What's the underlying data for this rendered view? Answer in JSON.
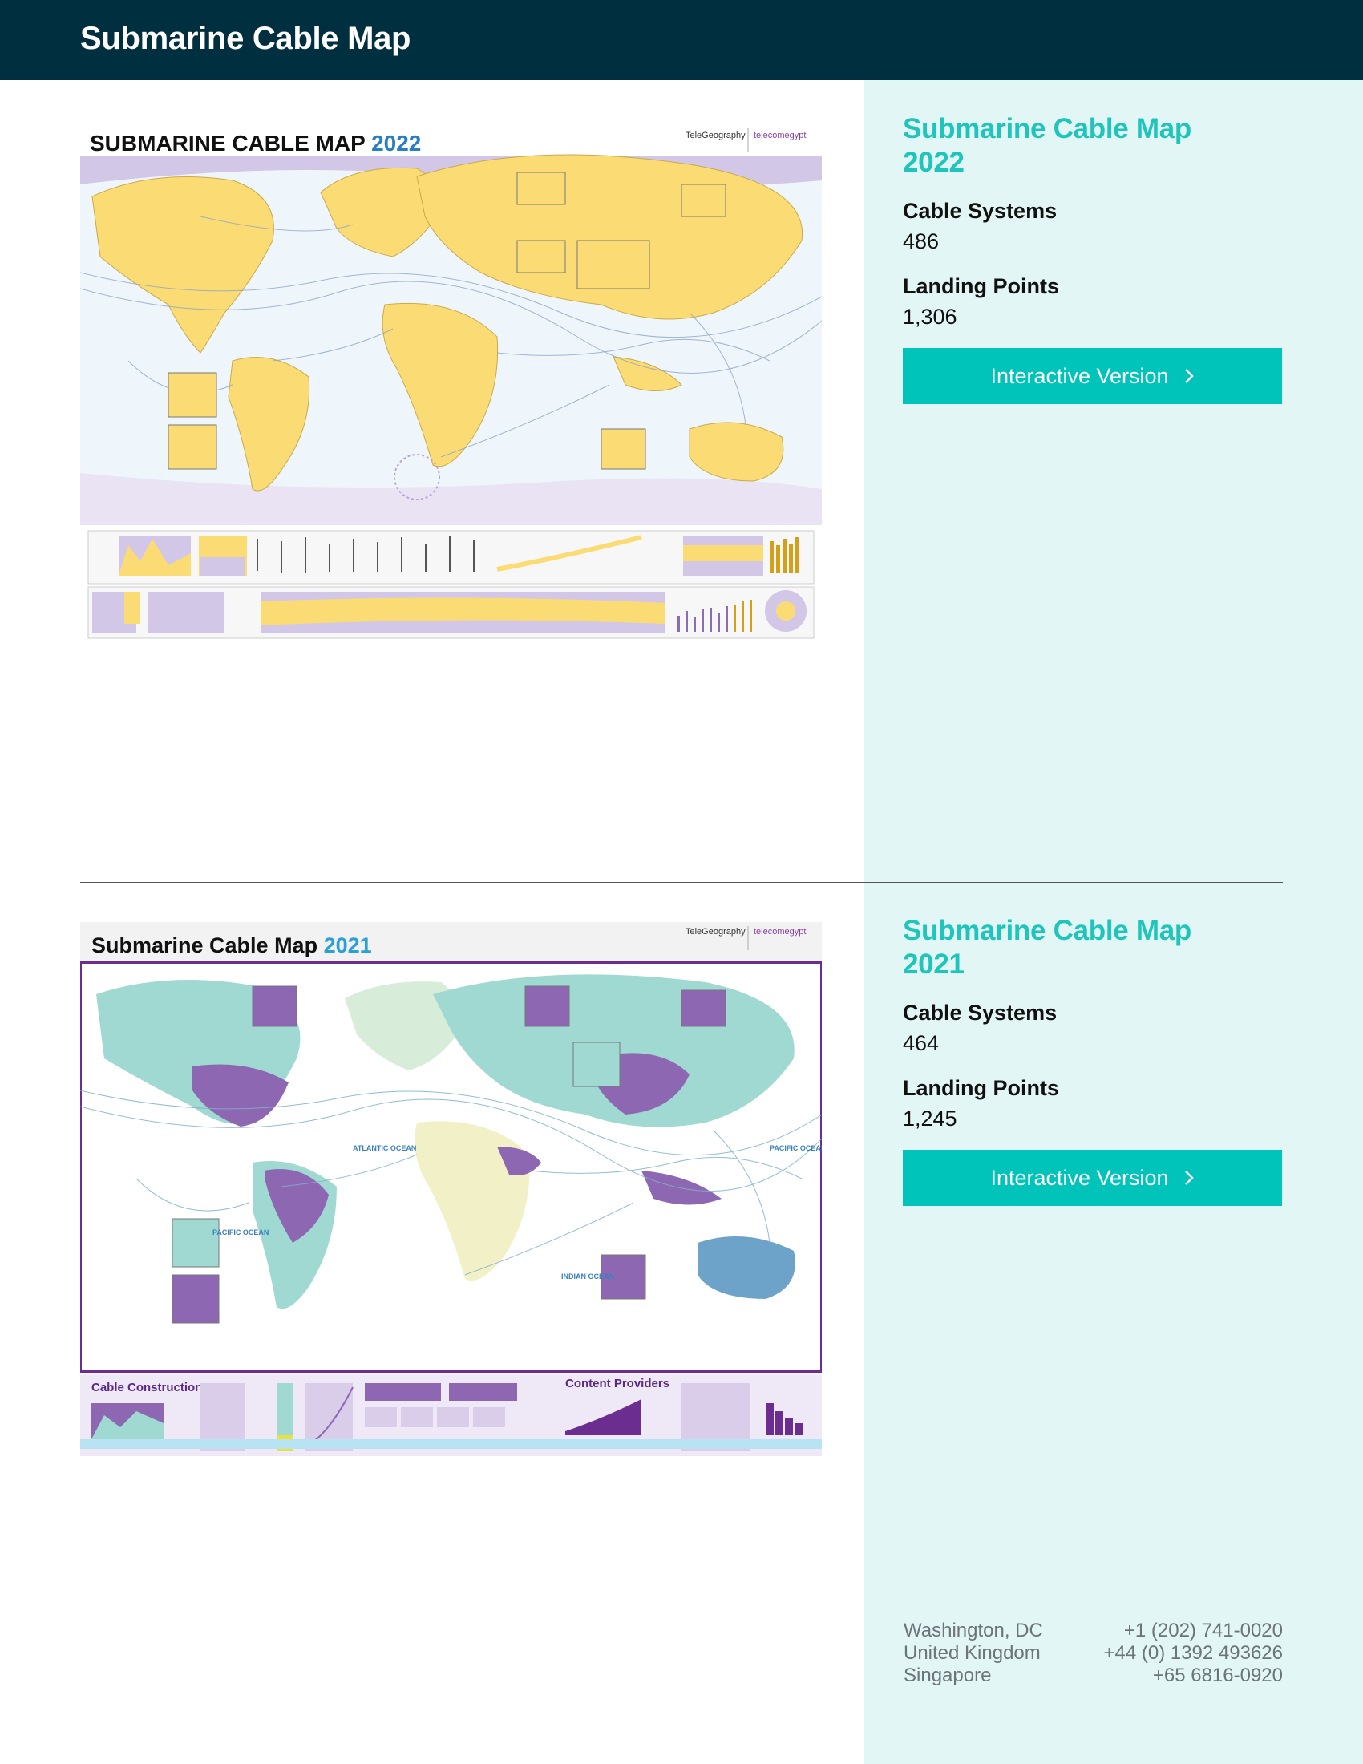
{
  "header": {
    "title": "Submarine Cable Map"
  },
  "maps": [
    {
      "poster_title": "SUBMARINE CABLE MAP",
      "poster_year": "2022",
      "poster_brand": "TeleGeography",
      "poster_partner": "telecomegypt",
      "title": "Submarine Cable Map 2022",
      "cable_systems_label": "Cable Systems",
      "cable_systems": "486",
      "landing_points_label": "Landing Points",
      "landing_points": "1,306",
      "button_label": "Interactive Version"
    },
    {
      "poster_title": "Submarine Cable Map",
      "poster_year": "2021",
      "poster_brand": "TeleGeography",
      "poster_partner": "telecomegypt",
      "title": "Submarine Cable Map 2021",
      "cable_systems_label": "Cable Systems",
      "cable_systems": "464",
      "landing_points_label": "Landing Points",
      "landing_points": "1,245",
      "button_label": "Interactive Version",
      "panel_labels": {
        "cable_construction": "Cable Construction",
        "content_providers": "Content Providers",
        "atlantic": "ATLANTIC OCEAN",
        "pacific": "PACIFIC OCEAN",
        "indian": "INDIAN OCEAN"
      }
    }
  ],
  "footer": {
    "offices": [
      {
        "city": "Washington, DC",
        "phone": "+1 (202) 741-0020"
      },
      {
        "city": "United Kingdom",
        "phone": "+44 (0) 1392 493626"
      },
      {
        "city": "Singapore",
        "phone": "+65 6816-0920"
      }
    ]
  },
  "colors": {
    "header_bg": "#002f40",
    "accent": "#00c3b9",
    "sidebar_bg": "#e2f6f5",
    "map2022_land": "#fbdc74",
    "map2022_region": "#d2c7e6",
    "map2021_land": "#9fd9d2",
    "map2021_highlight": "#8e67b3"
  }
}
